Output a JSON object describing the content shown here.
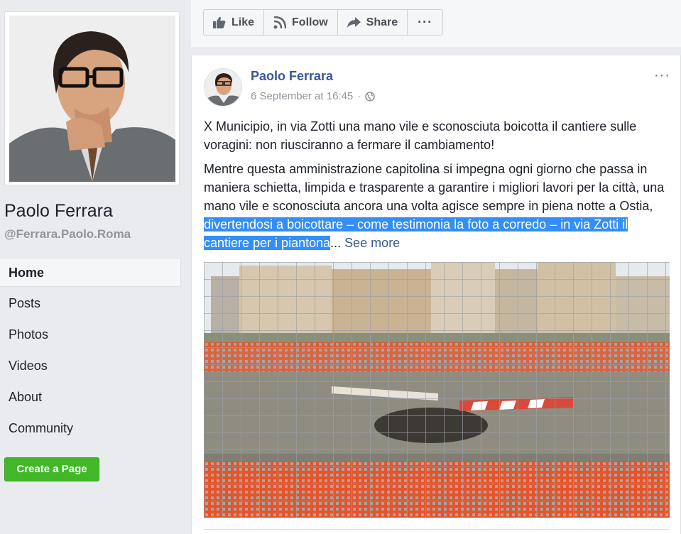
{
  "sidebar": {
    "page_name": "Paolo Ferrara",
    "handle": "@Ferrara.Paolo.Roma",
    "nav": [
      {
        "label": "Home",
        "active": true
      },
      {
        "label": "Posts"
      },
      {
        "label": "Photos"
      },
      {
        "label": "Videos"
      },
      {
        "label": "About"
      },
      {
        "label": "Community"
      }
    ],
    "create_page_label": "Create a Page"
  },
  "actions": {
    "like_label": "Like",
    "follow_label": "Follow",
    "share_label": "Share",
    "more_label": "···"
  },
  "post": {
    "author": "Paolo Ferrara",
    "timestamp": "6 September at 16:45",
    "meta_separator": "·",
    "options_label": "···",
    "paragraph1": "X Municipio, in via Zotti una mano vile e sconosciuta boicotta il cantiere sulle voragini: non riusciranno a fermare il cambiamento!",
    "paragraph2_plain": "Mentre questa amministrazione capitolina si impegna ogni giorno che passa in maniera schietta, limpida e trasparente a garantire i migliori lavori per la città, una mano vile e sconosciuta ancora una volta agisce sempre in piena notte a Ostia, ",
    "paragraph2_highlight": "divertendosi a boicottare – come testimonia la foto a corredo – in via Zotti il cantiere per i piantona",
    "ellipsis": "...",
    "see_more": "See more"
  },
  "colors": {
    "link": "#365899",
    "highlight": "#338ef7",
    "create_button": "#42b72a"
  }
}
